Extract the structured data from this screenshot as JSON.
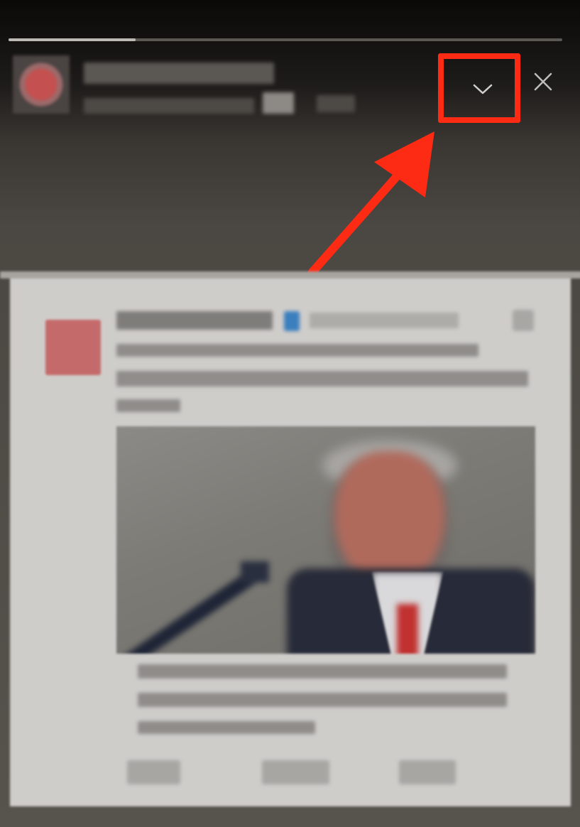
{
  "story": {
    "progress": 0.23,
    "account_name": "",
    "account_meta": ""
  },
  "controls": {
    "chevron_icon": "chevron-down-icon",
    "close_icon": "close-icon"
  },
  "annotation": {
    "highlight_color": "#fd2a14",
    "arrow_color": "#fd2a14"
  },
  "post": {
    "author": "",
    "text": "",
    "headline": "",
    "link_caption": "",
    "actions": [
      "",
      "",
      ""
    ]
  }
}
